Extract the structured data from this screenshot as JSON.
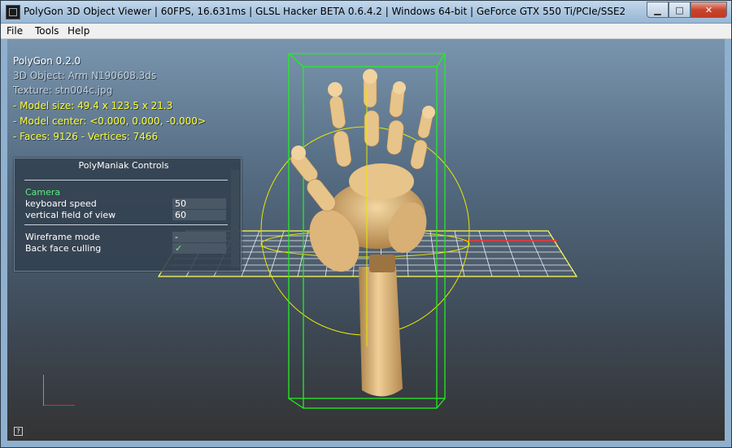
{
  "window": {
    "title": "PolyGon 3D Object Viewer | 60FPS, 16.631ms | GLSL Hacker BETA 0.6.4.2 | Windows 64-bit | GeForce GTX 550 Ti/PCIe/SSE2",
    "minimize_icon": "minimize-icon",
    "maximize_icon": "maximize-icon",
    "close_icon": "close-icon"
  },
  "menu": {
    "items": [
      "File",
      "Tools",
      "Help"
    ]
  },
  "info": {
    "app_version": "PolyGon 0.2.0",
    "object": "3D Object: Arm N190608.3ds",
    "texture": "Texture: stn004c.jpg",
    "model_size": "- Model size:  49.4 x 123.5 x 21.3",
    "model_center": "- Model center:  <0.000, 0.000, -0.000>",
    "faces_vertices": "- Faces: 9126 - Vertices: 7466"
  },
  "controls": {
    "title": "PolyManiak Controls",
    "section": "Camera",
    "keyboard_speed_label": "keyboard speed",
    "keyboard_speed_value": "50",
    "fov_label": "vertical field of view",
    "fov_value": "60",
    "wireframe_label": "Wireframe mode",
    "wireframe_value": "-",
    "backface_label": "Back face culling",
    "backface_value": "✓"
  },
  "footer": {
    "help_label": "?"
  },
  "colors": {
    "info_yellow": "#ffff33",
    "camera_green": "#5bf07a",
    "bbox_green": "#22ee22",
    "grid": "#f0f0f0",
    "circle_yellow": "#e8e800"
  }
}
